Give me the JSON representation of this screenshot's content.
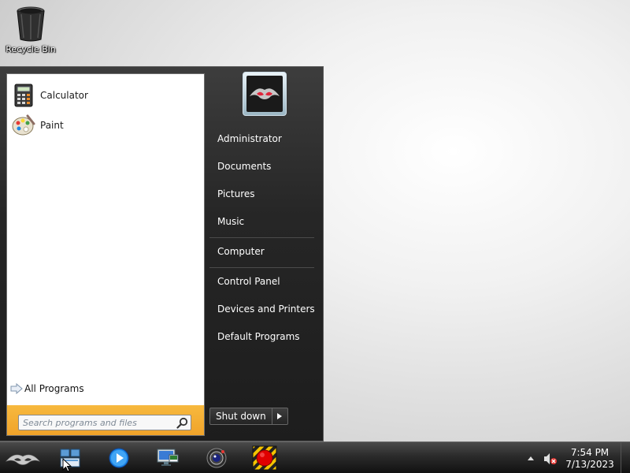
{
  "desktop": {
    "icons": [
      {
        "label": "Recycle Bin",
        "icon": "recycle-bin-icon"
      }
    ]
  },
  "start_menu": {
    "pinned_programs": [
      {
        "label": "Calculator",
        "icon": "calculator-icon"
      },
      {
        "label": "Paint",
        "icon": "paint-icon"
      }
    ],
    "all_programs_label": "All Programs",
    "search": {
      "placeholder": "Search programs and files",
      "value": ""
    },
    "user_picture_icon": "user-picture-icon",
    "right_links": [
      "Administrator",
      "Documents",
      "Pictures",
      "Music",
      "Computer",
      "Control Panel",
      "Devices and Printers",
      "Default Programs"
    ],
    "shutdown_label": "Shut down"
  },
  "taskbar": {
    "start_button_icon": "start-orb-icon",
    "pinned": [
      {
        "name": "windows-explorer-icon"
      },
      {
        "name": "media-player-icon"
      },
      {
        "name": "remote-desktop-icon"
      },
      {
        "name": "camera-icon"
      },
      {
        "name": "record-icon"
      }
    ],
    "tray": {
      "show_hidden_icon": "chevron-up-icon",
      "volume_icon": "volume-muted-icon"
    },
    "clock": {
      "time": "7:54 PM",
      "date": "7/13/2023"
    }
  },
  "colors": {
    "search_bar_accent": "#f0a32a",
    "menu_dark": "#262626",
    "record_red": "#e00000"
  }
}
